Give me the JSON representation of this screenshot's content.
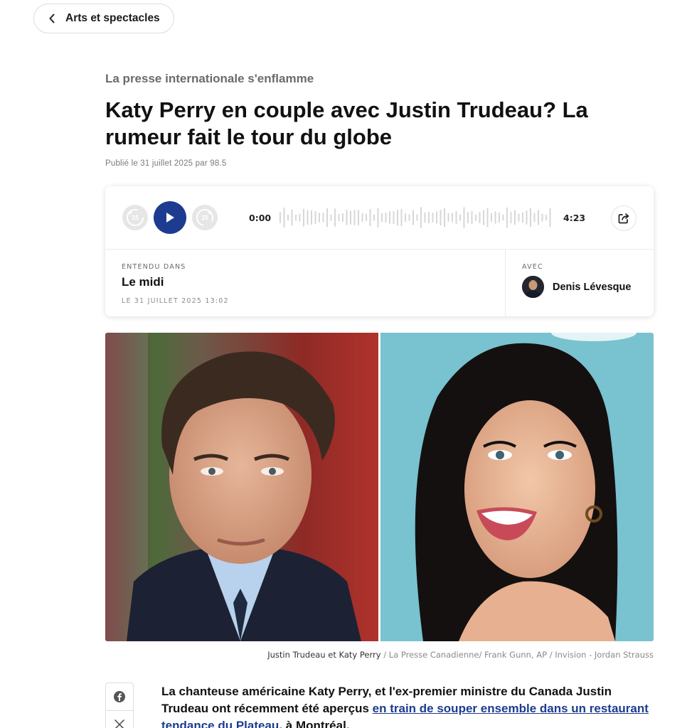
{
  "nav": {
    "back_label": "Arts et spectacles"
  },
  "article": {
    "kicker": "La presse internationale s'enflamme",
    "title": "Katy Perry en couple avec Justin Trudeau? La rumeur fait le tour du globe",
    "byline": "Publié le 31 juillet 2025 par 98.5"
  },
  "player": {
    "skip_back_seconds": "15",
    "skip_forward_seconds": "15",
    "current_time": "0:00",
    "total_time": "4:23",
    "heard_in_label": "ENTENDU DANS",
    "show_name": "Le midi",
    "air_date": "LE 31 JUILLET 2025 13:02",
    "with_label": "AVEC",
    "host_name": "Denis Lévesque",
    "accent_color": "#1d3c8f"
  },
  "photo": {
    "left_subject": "Justin Trudeau",
    "right_subject": "Katy Perry",
    "caption_people": "Justin Trudeau et Katy Perry",
    "caption_credit": " / La Presse Canadienne/ Frank Gunn, AP / Invision - Jordan Strauss"
  },
  "social": {
    "items": [
      "facebook-icon",
      "x-icon"
    ]
  },
  "lead": {
    "text_before": "La chanteuse américaine Katy Perry, et l'ex-premier ministre du Canada Justin Trudeau ont récemment été aperçus ",
    "link_text": "en train de souper ensemble dans un restaurant tendance du Plateau",
    "text_after": ", à Montréal."
  }
}
